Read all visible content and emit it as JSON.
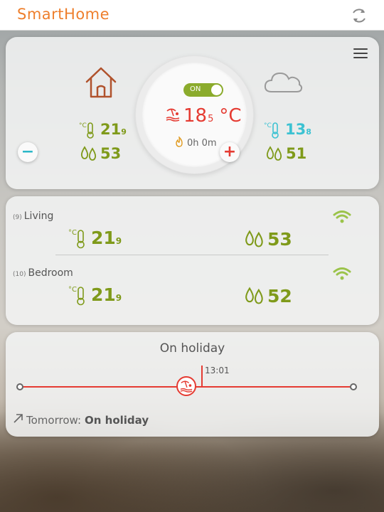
{
  "app": {
    "title": "SmartHome"
  },
  "thermostat": {
    "indoor": {
      "temp_int": "21",
      "temp_dec": "9",
      "humidity": "53"
    },
    "outdoor": {
      "temp_int": "13",
      "temp_dec": "8",
      "humidity": "51"
    },
    "power_label": "ON",
    "setpoint": {
      "int": "18",
      "dec": "5",
      "unit": "°C"
    },
    "timer": "0h 0m"
  },
  "rooms": [
    {
      "number": "(9)",
      "name": "Living",
      "temp_int": "21",
      "temp_dec": "9",
      "humidity": "53"
    },
    {
      "number": "(10)",
      "name": "Bedroom",
      "temp_int": "21",
      "temp_dec": "9",
      "humidity": "52"
    }
  ],
  "schedule": {
    "title": "On holiday",
    "now_time": "13:01",
    "tomorrow_label": "Tomorrow:",
    "tomorrow_mode": "On holiday"
  },
  "colors": {
    "accent": "#ee7f2d",
    "green": "#7f9a1a",
    "cyan": "#3cc2d2",
    "red": "#e53b32",
    "wifi": "#9bc34a"
  },
  "icons": {
    "refresh": "refresh-icon",
    "menu": "menu-icon",
    "house": "house-icon",
    "cloud": "cloud-icon",
    "thermometer": "thermometer-icon",
    "humidity": "droplets-icon",
    "holiday": "holiday-icon",
    "flame": "flame-icon",
    "wifi": "wifi-icon",
    "arrow": "arrow-up-right-icon"
  }
}
